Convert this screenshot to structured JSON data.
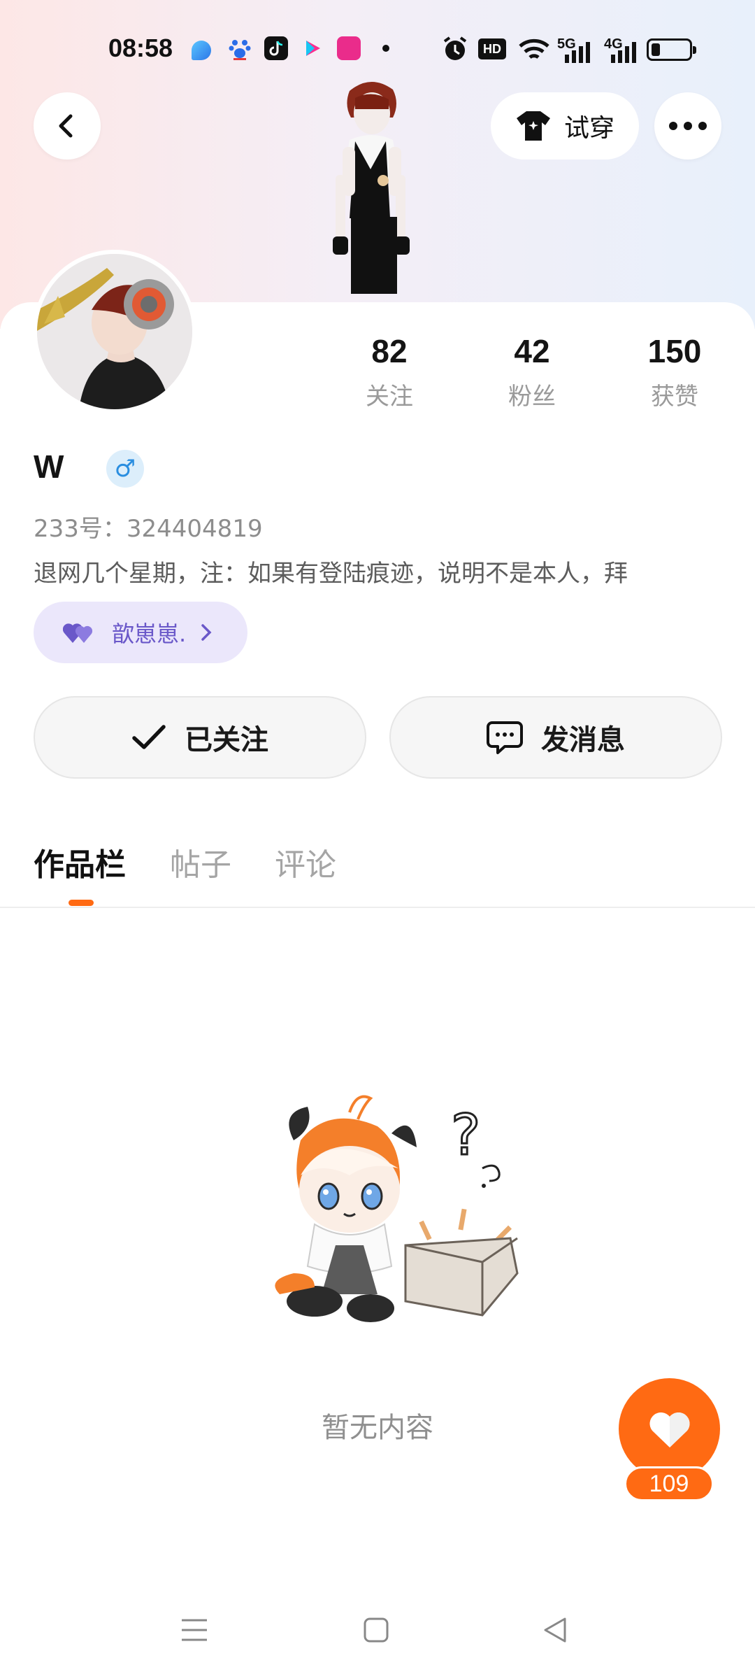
{
  "status_bar": {
    "time": "08:58",
    "network_1": "5G",
    "network_2": "4G",
    "hd_label": "HD",
    "icons": [
      "notification-app-icon",
      "baidu-icon",
      "douyin-icon",
      "youku-icon",
      "vipshop-icon",
      "alarm-icon",
      "wifi-icon",
      "signal-icon",
      "battery-icon"
    ]
  },
  "header": {
    "try_on_label": "试穿"
  },
  "profile": {
    "username": "W",
    "gender_symbol": "♂",
    "id_text": "233号：324404819",
    "bio": "退网几个星期，注：如果有登陆痕迹，说明不是本人，拜",
    "relation_label": "歆崽崽.",
    "stats": [
      {
        "value": "82",
        "label": "关注"
      },
      {
        "value": "42",
        "label": "粉丝"
      },
      {
        "value": "150",
        "label": "获赞"
      }
    ]
  },
  "actions": {
    "follow_label": "已关注",
    "message_label": "发消息"
  },
  "tabs": [
    {
      "label": "作品栏",
      "active": true
    },
    {
      "label": "帖子",
      "active": false
    },
    {
      "label": "评论",
      "active": false
    }
  ],
  "empty_state": {
    "text": "暂无内容"
  },
  "like_fab": {
    "count": "109"
  },
  "colors": {
    "accent_orange": "#ff6a13",
    "relation_purple": "#6a58c9",
    "gender_blue": "#2a8ee0"
  }
}
